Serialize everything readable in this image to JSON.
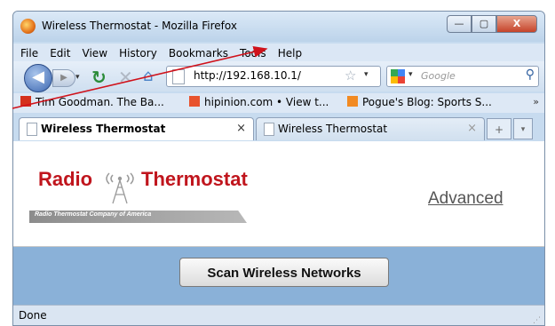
{
  "window": {
    "title": "Wireless Thermostat - Mozilla Firefox",
    "buttons": {
      "minimize": "—",
      "maximize": "▢",
      "close": "X"
    }
  },
  "menubar": [
    "File",
    "Edit",
    "View",
    "History",
    "Bookmarks",
    "Tools",
    "Help"
  ],
  "navbar": {
    "url": "http://192.168.10.1/",
    "search_placeholder": "Google"
  },
  "bookmarks": [
    {
      "label": "Tim Goodman. The Ba...",
      "icon_color": "#d4301c"
    },
    {
      "label": "hipinion.com • View t...",
      "icon_color": "#e8532e"
    },
    {
      "label": "Pogue's Blog: Sports S...",
      "icon_color": "#f28a22"
    }
  ],
  "bookmarks_more": "»",
  "tabs": [
    {
      "label": "Wireless Thermostat",
      "active": true
    },
    {
      "label": "Wireless Thermostat",
      "active": false
    }
  ],
  "tab_close": "×",
  "page": {
    "logo_left": "Radio",
    "logo_right": "Thermostat",
    "logo_sub": "Radio Thermostat Company of America",
    "advanced_link": "Advanced",
    "scan_button": "Scan Wireless Networks"
  },
  "status": "Done",
  "colors": {
    "logo_red": "#c0151d",
    "band_blue": "#8ab1d8",
    "annotation_red": "#d0121b"
  }
}
